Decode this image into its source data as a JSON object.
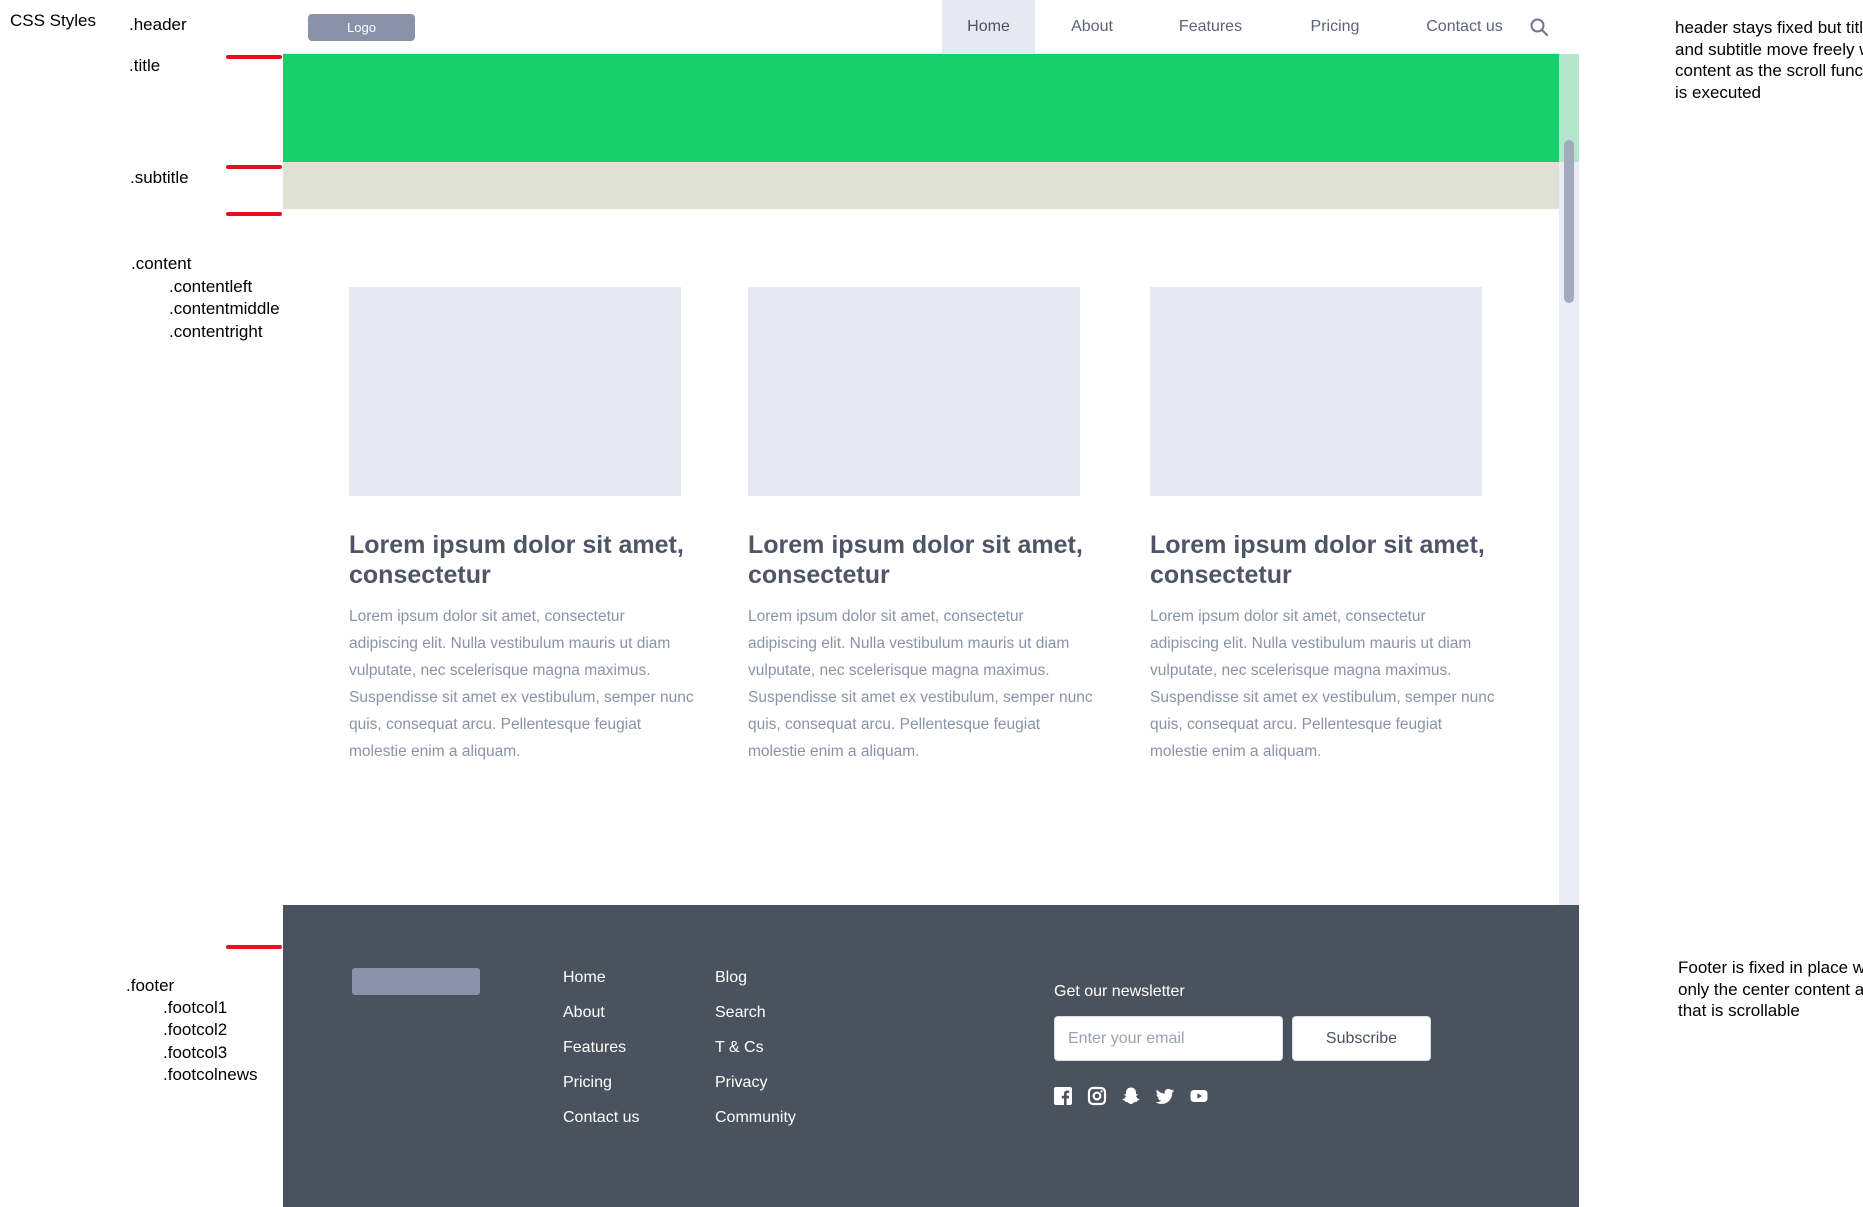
{
  "annotations": {
    "heading": "CSS Styles",
    "labels": {
      "header": ".header",
      "title": ".title",
      "subtitle": ".subtitle",
      "content": ".content",
      "contentleft": ".contentleft",
      "contentmiddle": ".contentmiddle",
      "contentright": ".contentright",
      "footer": ".footer",
      "footcol1": ".footcol1",
      "footcol2": ".footcol2",
      "footcol3": ".footcol3",
      "footcolnews": ".footcolnews"
    },
    "notes": {
      "header_note": "header stays fixed but title and subtitle move freely with content as the scroll function is executed",
      "footer_note": "Footer is fixed in place with only the center content area that is scrollable"
    },
    "marker_color": "#e8101b"
  },
  "header": {
    "logo": "Logo",
    "nav": [
      "Home",
      "About",
      "Features",
      "Pricing",
      "Contact us"
    ],
    "active_nav": "Home",
    "search_icon": "search-icon"
  },
  "colors": {
    "title_band": "#16d06b",
    "subtitle_band": "#dfe2d3",
    "placeholder": "#e6e9f1",
    "footer_bg": "#4a525d",
    "logo_bg": "#8893a9"
  },
  "content": {
    "cards": [
      {
        "heading": "Lorem ipsum dolor sit amet, consectetur",
        "body": "Lorem ipsum dolor sit amet, consectetur adipiscing elit. Nulla vestibulum mauris ut diam vulputate, nec scelerisque magna maximus. Suspendisse sit amet ex vestibulum, semper nunc quis, consequat arcu. Pellentesque feugiat molestie enim a aliquam."
      },
      {
        "heading": "Lorem ipsum dolor sit amet, consectetur",
        "body": "Lorem ipsum dolor sit amet, consectetur adipiscing elit. Nulla vestibulum mauris ut diam vulputate, nec scelerisque magna maximus. Suspendisse sit amet ex vestibulum, semper nunc quis, consequat arcu. Pellentesque feugiat molestie enim a aliquam."
      },
      {
        "heading": "Lorem ipsum dolor sit amet, consectetur",
        "body": "Lorem ipsum dolor sit amet, consectetur adipiscing elit. Nulla vestibulum mauris ut diam vulputate, nec scelerisque magna maximus. Suspendisse sit amet ex vestibulum, semper nunc quis, consequat arcu. Pellentesque feugiat molestie enim a aliquam."
      }
    ]
  },
  "footer": {
    "col1": [
      "Home",
      "About",
      "Features",
      "Pricing",
      "Contact us"
    ],
    "col2": [
      "Blog",
      "Search",
      "T & Cs",
      "Privacy",
      "Community"
    ],
    "newsletter": {
      "label": "Get our newsletter",
      "placeholder": "Enter your email",
      "button": "Subscribe"
    },
    "social_icons": [
      "facebook-icon",
      "instagram-icon",
      "snapchat-icon",
      "twitter-icon",
      "youtube-icon"
    ]
  }
}
